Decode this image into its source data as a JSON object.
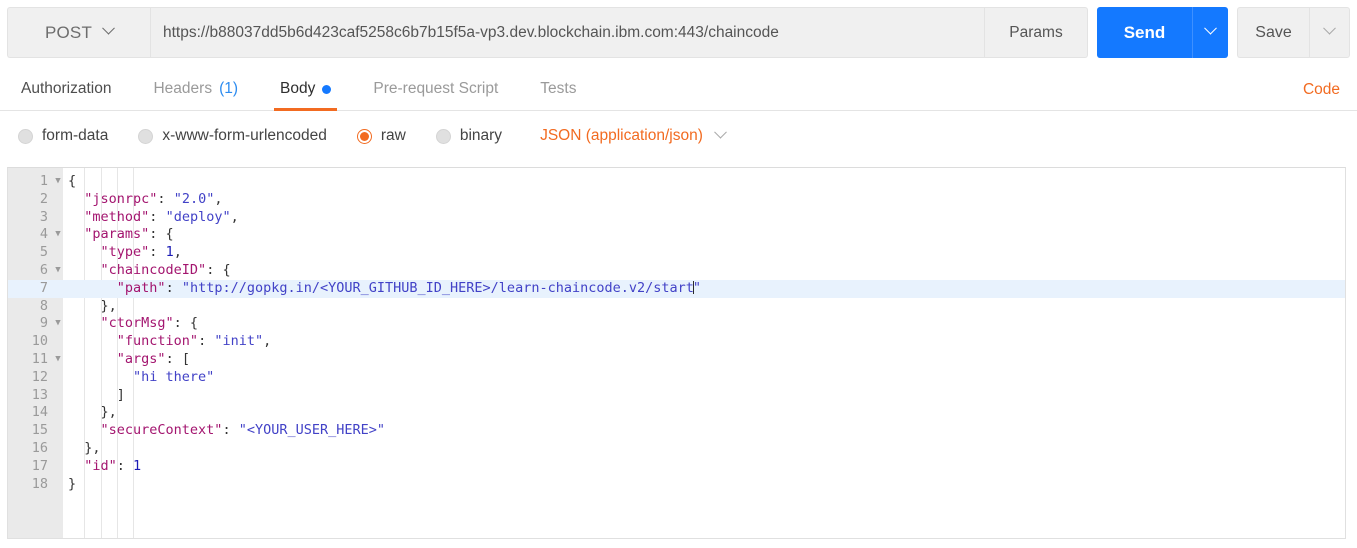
{
  "request": {
    "method": "POST",
    "url": "https://b88037dd5b6d423caf5258c6b7b15f5a-vp3.dev.blockchain.ibm.com:443/chaincode",
    "params_label": "Params",
    "send_label": "Send",
    "save_label": "Save",
    "method_caret_icon": "chevron-down-icon",
    "send_caret_icon": "chevron-down-icon",
    "save_caret_icon": "chevron-down-icon"
  },
  "tabs": [
    {
      "label": "Authorization",
      "count": "",
      "dot": false,
      "active": false,
      "dark": true
    },
    {
      "label": "Headers",
      "count": "(1)",
      "dot": false,
      "active": false,
      "dark": false
    },
    {
      "label": "Body",
      "count": "",
      "dot": true,
      "active": true,
      "dark": false
    },
    {
      "label": "Pre-request Script",
      "count": "",
      "dot": false,
      "active": false,
      "dark": false
    },
    {
      "label": "Tests",
      "count": "",
      "dot": false,
      "active": false,
      "dark": false
    }
  ],
  "code_link": "Code",
  "body_types": [
    {
      "label": "form-data",
      "selected": false
    },
    {
      "label": "x-www-form-urlencoded",
      "selected": false
    },
    {
      "label": "raw",
      "selected": true
    },
    {
      "label": "binary",
      "selected": false
    }
  ],
  "content_type": {
    "label": "JSON (application/json)",
    "caret_icon": "chevron-down-icon"
  },
  "colors": {
    "accent_orange": "#f26b21",
    "send_blue": "#1479ff",
    "link_blue": "#2d8cf0",
    "json_key": "#a3156f",
    "json_string": "#4242c7",
    "json_number": "#1a1ab5",
    "active_line": "#e8f2fd",
    "gutter": "#eaeaea"
  },
  "editor": {
    "active_line_number": 7,
    "total_lines": 18,
    "lines": [
      {
        "n": 1,
        "fold": true,
        "indent": 0,
        "tokens": [
          {
            "t": "p",
            "v": "{"
          }
        ]
      },
      {
        "n": 2,
        "fold": false,
        "indent": 1,
        "tokens": [
          {
            "t": "k",
            "v": "\"jsonrpc\""
          },
          {
            "t": "p",
            "v": ": "
          },
          {
            "t": "s",
            "v": "\"2.0\""
          },
          {
            "t": "p",
            "v": ","
          }
        ]
      },
      {
        "n": 3,
        "fold": false,
        "indent": 1,
        "tokens": [
          {
            "t": "k",
            "v": "\"method\""
          },
          {
            "t": "p",
            "v": ": "
          },
          {
            "t": "s",
            "v": "\"deploy\""
          },
          {
            "t": "p",
            "v": ","
          }
        ]
      },
      {
        "n": 4,
        "fold": true,
        "indent": 1,
        "tokens": [
          {
            "t": "k",
            "v": "\"params\""
          },
          {
            "t": "p",
            "v": ": {"
          }
        ]
      },
      {
        "n": 5,
        "fold": false,
        "indent": 2,
        "tokens": [
          {
            "t": "k",
            "v": "\"type\""
          },
          {
            "t": "p",
            "v": ": "
          },
          {
            "t": "n",
            "v": "1"
          },
          {
            "t": "p",
            "v": ","
          }
        ]
      },
      {
        "n": 6,
        "fold": true,
        "indent": 2,
        "tokens": [
          {
            "t": "k",
            "v": "\"chaincodeID\""
          },
          {
            "t": "p",
            "v": ": {"
          }
        ]
      },
      {
        "n": 7,
        "fold": false,
        "indent": 3,
        "tokens": [
          {
            "t": "k",
            "v": "\"path\""
          },
          {
            "t": "p",
            "v": ": "
          },
          {
            "t": "s",
            "v": "\"http://gopkg.in/<YOUR_GITHUB_ID_HERE>/learn-chaincode.v2/start"
          },
          {
            "t": "caret",
            "v": ""
          },
          {
            "t": "s",
            "v": "\""
          }
        ]
      },
      {
        "n": 8,
        "fold": false,
        "indent": 2,
        "tokens": [
          {
            "t": "p",
            "v": "},"
          }
        ]
      },
      {
        "n": 9,
        "fold": true,
        "indent": 2,
        "tokens": [
          {
            "t": "k",
            "v": "\"ctorMsg\""
          },
          {
            "t": "p",
            "v": ": {"
          }
        ]
      },
      {
        "n": 10,
        "fold": false,
        "indent": 3,
        "tokens": [
          {
            "t": "k",
            "v": "\"function\""
          },
          {
            "t": "p",
            "v": ": "
          },
          {
            "t": "s",
            "v": "\"init\""
          },
          {
            "t": "p",
            "v": ","
          }
        ]
      },
      {
        "n": 11,
        "fold": true,
        "indent": 3,
        "tokens": [
          {
            "t": "k",
            "v": "\"args\""
          },
          {
            "t": "p",
            "v": ": ["
          }
        ]
      },
      {
        "n": 12,
        "fold": false,
        "indent": 4,
        "tokens": [
          {
            "t": "s",
            "v": "\"hi there\""
          }
        ]
      },
      {
        "n": 13,
        "fold": false,
        "indent": 3,
        "tokens": [
          {
            "t": "p",
            "v": "]"
          }
        ]
      },
      {
        "n": 14,
        "fold": false,
        "indent": 2,
        "tokens": [
          {
            "t": "p",
            "v": "},"
          }
        ]
      },
      {
        "n": 15,
        "fold": false,
        "indent": 2,
        "tokens": [
          {
            "t": "k",
            "v": "\"secureContext\""
          },
          {
            "t": "p",
            "v": ": "
          },
          {
            "t": "s",
            "v": "\"<YOUR_USER_HERE>\""
          }
        ]
      },
      {
        "n": 16,
        "fold": false,
        "indent": 1,
        "tokens": [
          {
            "t": "p",
            "v": "},"
          }
        ]
      },
      {
        "n": 17,
        "fold": false,
        "indent": 1,
        "tokens": [
          {
            "t": "k",
            "v": "\"id\""
          },
          {
            "t": "p",
            "v": ": "
          },
          {
            "t": "n",
            "v": "1"
          }
        ]
      },
      {
        "n": 18,
        "fold": false,
        "indent": 0,
        "tokens": [
          {
            "t": "p",
            "v": "}"
          }
        ]
      }
    ]
  }
}
